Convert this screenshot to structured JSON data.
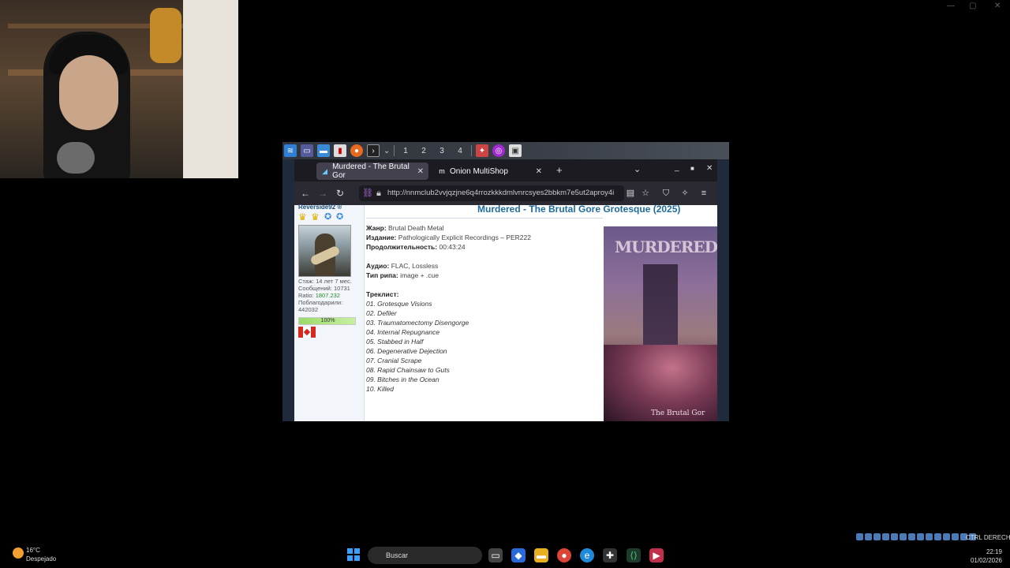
{
  "remote_taskbar": {
    "workspaces": [
      "1",
      "2",
      "3",
      "4"
    ]
  },
  "browser": {
    "tabs": [
      {
        "label": "Murdered - The Brutal Gor",
        "active": true
      },
      {
        "label": "Onion MultiShop",
        "active": false
      }
    ],
    "url": "http://nnmclub2vvjqzjne6q4rrozkkkdmlvnrcsyes2bbkm7e5ut2aproy4i"
  },
  "post": {
    "title": "Murdered - The Brutal Gore Grotesque (2025)",
    "genre_label": "Жанр:",
    "genre": "Brutal Death Metal",
    "label_label": "Издание:",
    "label": "Pathologically Explicit Recordings – PER222",
    "duration_label": "Продолжительность:",
    "duration": "00:43:24",
    "audio_label": "Аудио:",
    "audio": "FLAC, Lossless",
    "rip_label": "Тип рипа:",
    "rip": "image + .cue",
    "tracklist_label": "Треклист:",
    "tracks": [
      "01. Grotesque Visions",
      "02. Defiler",
      "03. Traumatomectomy Disengorge",
      "04. Internal Repugnance",
      "05. Stabbed in Half",
      "06. Degenerative Dejection",
      "07. Cranial Scrape",
      "08. Rapid Chainsaw to Guts",
      "09. Bitches in the Ocean",
      "10. Killed"
    ],
    "cover_logo": "MURDERED",
    "cover_subtitle": "The Brutal Gor"
  },
  "user": {
    "name": "Reverside92 ®",
    "tenure": "Стаж: 14 лет 7 мес.",
    "messages": "Сообщений: 10731",
    "ratio_label": "Ratio:",
    "ratio": "1807.232",
    "thanked_label": "Поблагодарили:",
    "thanked": "442032",
    "progress": 1.0,
    "progress_text": "100%"
  },
  "taskbar": {
    "temperature": "16°C",
    "condition": "Despejado",
    "search_placeholder": "Buscar",
    "ctrl_label": "CTRL DERECHA",
    "time": "22:19",
    "date": "01/02/2026"
  },
  "colors": {
    "title_link": "#1f6c9c",
    "browser_chrome": "#1c1b22"
  }
}
